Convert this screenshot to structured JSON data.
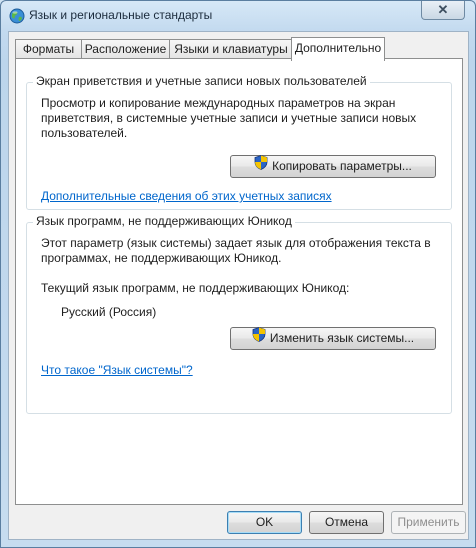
{
  "window": {
    "title": "Язык и региональные стандарты",
    "close_glyph": "✕"
  },
  "tabs": [
    {
      "label": "Форматы"
    },
    {
      "label": "Расположение"
    },
    {
      "label": "Языки и клавиатуры"
    },
    {
      "label": "Дополнительно",
      "active": true
    }
  ],
  "welcome_group": {
    "title": "Экран приветствия и учетные записи новых пользователей",
    "description_lines": [
      "Просмотр и копирование международных параметров на экран",
      "приветствия, в системные учетные записи и учетные записи новых",
      "пользователей."
    ],
    "copy_button": "Копировать параметры...",
    "link": "Дополнительные сведения об этих учетных записях"
  },
  "nonunicode_group": {
    "title": "Язык программ, не поддерживающих Юникод",
    "description_lines": [
      "Этот параметр (язык системы) задает язык для отображения текста в",
      "программах, не поддерживающих Юникод."
    ],
    "current_label": "Текущий язык программ, не поддерживающих Юникод:",
    "current_value": "Русский (Россия)",
    "change_button": "Изменить язык системы...",
    "link": "Что такое \"Язык системы\"?"
  },
  "footer": {
    "ok": "OK",
    "cancel": "Отмена",
    "apply": "Применить"
  },
  "icons": {
    "title_icon": "globe-icon",
    "button_icon": "uac-shield-icon"
  },
  "colors": {
    "link": "#0066cc",
    "default_button_border": "#3c7fb1"
  }
}
